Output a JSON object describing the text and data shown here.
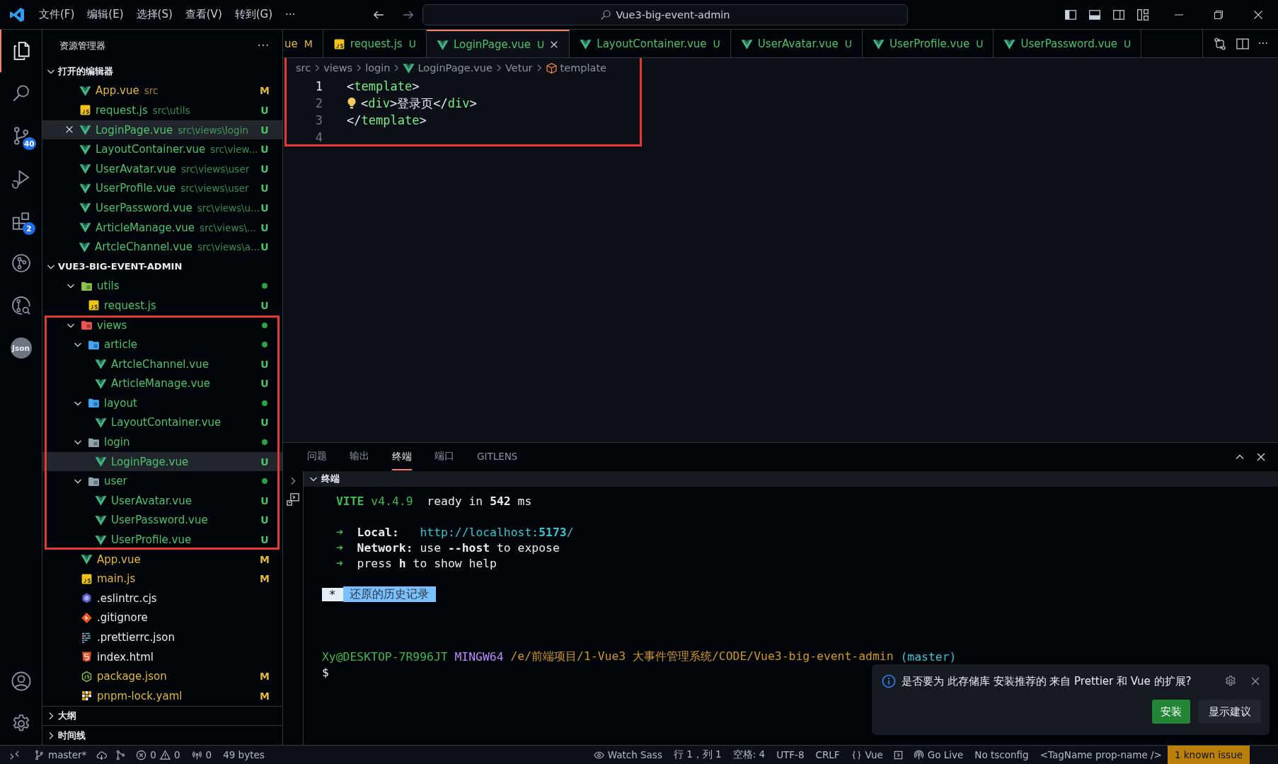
{
  "title_bar": {
    "menus": [
      "文件(F)",
      "编辑(E)",
      "选择(S)",
      "查看(V)",
      "转到(G)",
      "···"
    ],
    "search": {
      "value": "Vue3-big-event-admin"
    },
    "layout_toggles": [
      {
        "kind": "primary-sidebar",
        "on": true
      },
      {
        "kind": "panel",
        "on": true
      },
      {
        "kind": "secondary-sidebar",
        "on": false
      },
      {
        "kind": "customize",
        "on": false
      }
    ]
  },
  "activity_bar": {
    "items": [
      {
        "kind": "explorer",
        "selected": true
      },
      {
        "kind": "search",
        "selected": false
      },
      {
        "kind": "source-control",
        "selected": false,
        "badge": "40"
      },
      {
        "kind": "run-debug",
        "selected": false
      },
      {
        "kind": "extensions",
        "selected": false,
        "badge": "2"
      },
      {
        "kind": "git-graph",
        "selected": false
      },
      {
        "kind": "inspect",
        "selected": false
      },
      {
        "kind": "label",
        "label": "Json",
        "selected": false
      }
    ],
    "bottom": [
      {
        "kind": "account"
      },
      {
        "kind": "settings"
      }
    ]
  },
  "explorer": {
    "title": "资源管理器",
    "more": "···",
    "open_editors": {
      "title": "打开的编辑器",
      "expanded": true,
      "items": [
        {
          "kind": "vue",
          "name": "App.vue",
          "path": "src",
          "status": "M",
          "color": "#e2b93d",
          "selected": false
        },
        {
          "kind": "js",
          "name": "request.js",
          "path": "src\\utils",
          "status": "U",
          "color": "#4fc16b",
          "selected": false
        },
        {
          "kind": "vue",
          "name": "LoginPage.vue",
          "path": "src\\views\\login",
          "status": "U",
          "color": "#4fc16b",
          "selected": true
        },
        {
          "kind": "vue",
          "name": "LayoutContainer.vue",
          "path": "src\\view...",
          "status": "U",
          "color": "#4fc16b",
          "selected": false
        },
        {
          "kind": "vue",
          "name": "UserAvatar.vue",
          "path": "src\\views\\user",
          "status": "U",
          "color": "#4fc16b",
          "selected": false
        },
        {
          "kind": "vue",
          "name": "UserProfile.vue",
          "path": "src\\views\\user",
          "status": "U",
          "color": "#4fc16b",
          "selected": false
        },
        {
          "kind": "vue",
          "name": "UserPassword.vue",
          "path": "src\\views\\u...",
          "status": "U",
          "color": "#4fc16b",
          "selected": false
        },
        {
          "kind": "vue",
          "name": "ArticleManage.vue",
          "path": "src\\views\\...",
          "status": "U",
          "color": "#4fc16b",
          "selected": false
        },
        {
          "kind": "vue",
          "name": "ArtcleChannel.vue",
          "path": "src\\views\\a...",
          "status": "U",
          "color": "#4fc16b",
          "selected": false
        }
      ]
    },
    "project": {
      "title": "VUE3-BIG-EVENT-ADMIN",
      "expanded": true,
      "tree": [
        {
          "kind": "utils-folder",
          "name": "utils",
          "color": "#4fc16b",
          "expanded": true,
          "changes": true,
          "highlighted": false,
          "children": [
            {
              "kind": "js",
              "name": "request.js",
              "status": "U",
              "color": "#4fc16b",
              "selected": false
            }
          ]
        },
        {
          "kind": "views-folder",
          "name": "views",
          "color": "#4fc16b",
          "expanded": true,
          "changes": true,
          "highlighted": true,
          "children": [
            {
              "kind": "article-folder",
              "name": "article",
              "color": "#4fc16b",
              "expanded": true,
              "changes": true,
              "highlighted": false,
              "children": [
                {
                  "kind": "vue",
                  "name": "ArtcleChannel.vue",
                  "status": "U",
                  "color": "#4fc16b",
                  "selected": false
                },
                {
                  "kind": "vue",
                  "name": "ArticleManage.vue",
                  "status": "U",
                  "color": "#4fc16b",
                  "selected": false
                }
              ]
            },
            {
              "kind": "layout-folder",
              "name": "layout",
              "color": "#4fc16b",
              "expanded": true,
              "changes": true,
              "highlighted": false,
              "children": [
                {
                  "kind": "vue",
                  "name": "LayoutContainer.vue",
                  "status": "U",
                  "color": "#4fc16b",
                  "selected": false
                }
              ]
            },
            {
              "kind": "plain-folder",
              "name": "login",
              "color": "#4fc16b",
              "expanded": true,
              "changes": true,
              "highlighted": false,
              "children": [
                {
                  "kind": "vue",
                  "name": "LoginPage.vue",
                  "status": "U",
                  "color": "#4fc16b",
                  "selected": true
                }
              ]
            },
            {
              "kind": "plain-folder",
              "name": "user",
              "color": "#4fc16b",
              "expanded": true,
              "changes": true,
              "highlighted": false,
              "children": [
                {
                  "kind": "vue",
                  "name": "UserAvatar.vue",
                  "status": "U",
                  "color": "#4fc16b",
                  "selected": false
                },
                {
                  "kind": "vue",
                  "name": "UserPassword.vue",
                  "status": "U",
                  "color": "#4fc16b",
                  "selected": false
                },
                {
                  "kind": "vue",
                  "name": "UserProfile.vue",
                  "status": "U",
                  "color": "#4fc16b",
                  "selected": false
                }
              ]
            }
          ]
        },
        {
          "kind": "vue",
          "name": "App.vue",
          "status": "M",
          "color": "#e2b93d",
          "selected": false
        },
        {
          "kind": "js",
          "name": "main.js",
          "status": "M",
          "color": "#e2b93d",
          "selected": false
        },
        {
          "kind": "eslint",
          "name": ".eslintrc.cjs",
          "color": "#e6edf3",
          "selected": false
        },
        {
          "kind": "git",
          "name": ".gitignore",
          "color": "#e6edf3",
          "selected": false
        },
        {
          "kind": "prettier",
          "name": ".prettierrc.json",
          "color": "#e6edf3",
          "selected": false
        },
        {
          "kind": "html",
          "name": "index.html",
          "color": "#e6edf3",
          "selected": false
        },
        {
          "kind": "node",
          "name": "package.json",
          "status": "M",
          "color": "#e2b93d",
          "selected": false
        },
        {
          "kind": "yaml",
          "name": "pnpm-lock.yaml",
          "status": "M",
          "color": "#e2b93d",
          "selected": false
        }
      ]
    },
    "outline": {
      "title": "大纲",
      "expanded": false
    },
    "timeline": {
      "title": "时间线",
      "expanded": false
    }
  },
  "tabs": [
    {
      "kind": "partial",
      "label": "ue",
      "status": "M",
      "color": "#e2b93d",
      "selected": false
    },
    {
      "kind": "js",
      "label": "request.js",
      "status": "U",
      "color": "#4fc16b",
      "selected": false
    },
    {
      "kind": "vue",
      "label": "LoginPage.vue",
      "status": "U",
      "color": "#4fc16b",
      "selected": true
    },
    {
      "kind": "vue",
      "label": "LayoutContainer.vue",
      "status": "U",
      "color": "#4fc16b",
      "selected": false
    },
    {
      "kind": "vue",
      "label": "UserAvatar.vue",
      "status": "U",
      "color": "#4fc16b",
      "selected": false
    },
    {
      "kind": "vue",
      "label": "UserProfile.vue",
      "status": "U",
      "color": "#4fc16b",
      "selected": false
    },
    {
      "kind": "vue",
      "label": "UserPassword.vue",
      "status": "U",
      "color": "#4fc16b",
      "selected": false
    }
  ],
  "tab_actions": {
    "more": "···"
  },
  "breadcrumb": [
    {
      "kind": "segment",
      "label": "src"
    },
    {
      "kind": "segment",
      "label": "views"
    },
    {
      "kind": "segment",
      "label": "login"
    },
    {
      "kind": "vue",
      "label": "LoginPage.vue"
    },
    {
      "kind": "segment",
      "label": "Vetur"
    },
    {
      "kind": "symbol",
      "label": "template"
    }
  ],
  "editor": {
    "highlighted": true,
    "lines": [
      {
        "number": "1",
        "current": true,
        "lightbulb": false,
        "tokens": [
          {
            "text": "<",
            "kind": "punct"
          },
          {
            "text": "template",
            "kind": "tag"
          },
          {
            "text": ">",
            "kind": "punct"
          }
        ]
      },
      {
        "number": "2",
        "current": false,
        "lightbulb": true,
        "tokens": [
          {
            "text": "<",
            "kind": "punct"
          },
          {
            "text": "div",
            "kind": "tag"
          },
          {
            "text": ">",
            "kind": "punct"
          },
          {
            "text": "登录页",
            "kind": "text"
          },
          {
            "text": "</",
            "kind": "punct"
          },
          {
            "text": "div",
            "kind": "tag"
          },
          {
            "text": ">",
            "kind": "punct"
          }
        ]
      },
      {
        "number": "3",
        "current": false,
        "lightbulb": false,
        "tokens": [
          {
            "text": "</",
            "kind": "punct"
          },
          {
            "text": "template",
            "kind": "tag"
          },
          {
            "text": ">",
            "kind": "punct"
          }
        ]
      },
      {
        "number": "4",
        "current": false,
        "lightbulb": false
      }
    ]
  },
  "panel": {
    "tabs": [
      {
        "label": "问题",
        "selected": false
      },
      {
        "label": "输出",
        "selected": false
      },
      {
        "label": "终端",
        "selected": true
      },
      {
        "label": "端口",
        "selected": false
      },
      {
        "label": "GITLENS",
        "selected": false
      }
    ],
    "terminal": {
      "title": "终端",
      "expanded": true,
      "lines": [
        {
          "kind": "indented",
          "segments": [
            {
              "kind": "brand",
              "text": "VITE"
            },
            {
              "kind": "version",
              "text": " v4.4.9"
            },
            {
              "kind": "plain",
              "text": "  ready in "
            },
            {
              "kind": "bold",
              "text": "542"
            },
            {
              "kind": "plain",
              "text": " ms"
            }
          ]
        },
        {
          "kind": "blank"
        },
        {
          "kind": "indented",
          "segments": [
            {
              "kind": "arrow",
              "text": "➜"
            },
            {
              "kind": "bold",
              "text": "  Local:"
            },
            {
              "kind": "url",
              "text": "   http://localhost:"
            },
            {
              "kind": "url-bold",
              "text": "5173"
            },
            {
              "kind": "url",
              "text": "/"
            }
          ]
        },
        {
          "kind": "indented",
          "segments": [
            {
              "kind": "arrow",
              "text": "➜"
            },
            {
              "kind": "bold",
              "text": "  Network:"
            },
            {
              "kind": "plain",
              "text": " use "
            },
            {
              "kind": "bold",
              "text": "--host"
            },
            {
              "kind": "plain",
              "text": " to expose"
            }
          ]
        },
        {
          "kind": "indented",
          "segments": [
            {
              "kind": "arrow",
              "text": "➜"
            },
            {
              "kind": "plain",
              "text": "  press "
            },
            {
              "kind": "bold",
              "text": "h"
            },
            {
              "kind": "plain",
              "text": " to show help"
            }
          ]
        },
        {
          "kind": "blank"
        },
        {
          "kind": "plain",
          "segments": [
            {
              "kind": "badge-star",
              "text": " * "
            },
            {
              "kind": "badge-label",
              "text": " 还原的历史记录 "
            }
          ]
        },
        {
          "kind": "blank"
        },
        {
          "kind": "blank"
        },
        {
          "kind": "blank"
        },
        {
          "kind": "plain",
          "segments": [
            {
              "kind": "user",
              "text": "Xy@DESKTOP-7R996JT"
            },
            {
              "kind": "system",
              "text": " MINGW64"
            },
            {
              "kind": "path",
              "text": " /e/前端项目/1-Vue3 大事件管理系统/CODE/Vue3-big-event-admin"
            },
            {
              "kind": "branch",
              "text": " (master)"
            }
          ]
        },
        {
          "kind": "plain",
          "segments": [
            {
              "kind": "plain",
              "text": "$"
            }
          ]
        }
      ]
    }
  },
  "notification": {
    "message": "是否要为 此存储库 安装推荐的 来自 Prettier 和 Vue 的扩展?",
    "buttons": [
      {
        "label": "安装",
        "primary": true
      },
      {
        "label": "显示建议",
        "primary": false
      }
    ]
  },
  "status_bar": {
    "left": [
      {
        "kind": "remote"
      },
      {
        "kind": "branch",
        "text": "master*"
      },
      {
        "kind": "sync"
      },
      {
        "kind": "compare"
      },
      {
        "kind": "problems",
        "errors": "0",
        "warnings": "0"
      },
      {
        "kind": "ports",
        "text": "0"
      },
      {
        "kind": "text",
        "text": "49 bytes"
      }
    ],
    "right": [
      {
        "kind": "eye",
        "text": "Watch Sass"
      },
      {
        "kind": "text",
        "text": "行 1，列 1"
      },
      {
        "kind": "text",
        "text": "空格: 4"
      },
      {
        "kind": "text",
        "text": "UTF-8"
      },
      {
        "kind": "text",
        "text": "CRLF"
      },
      {
        "kind": "braces",
        "text": "Vue"
      },
      {
        "kind": "box"
      },
      {
        "kind": "broadcast",
        "text": "Go Live"
      },
      {
        "kind": "text",
        "text": "No tsconfig"
      },
      {
        "kind": "text",
        "text": "<TagName prop-name />"
      },
      {
        "kind": "warning",
        "text": "1 known issue"
      }
    ]
  }
}
